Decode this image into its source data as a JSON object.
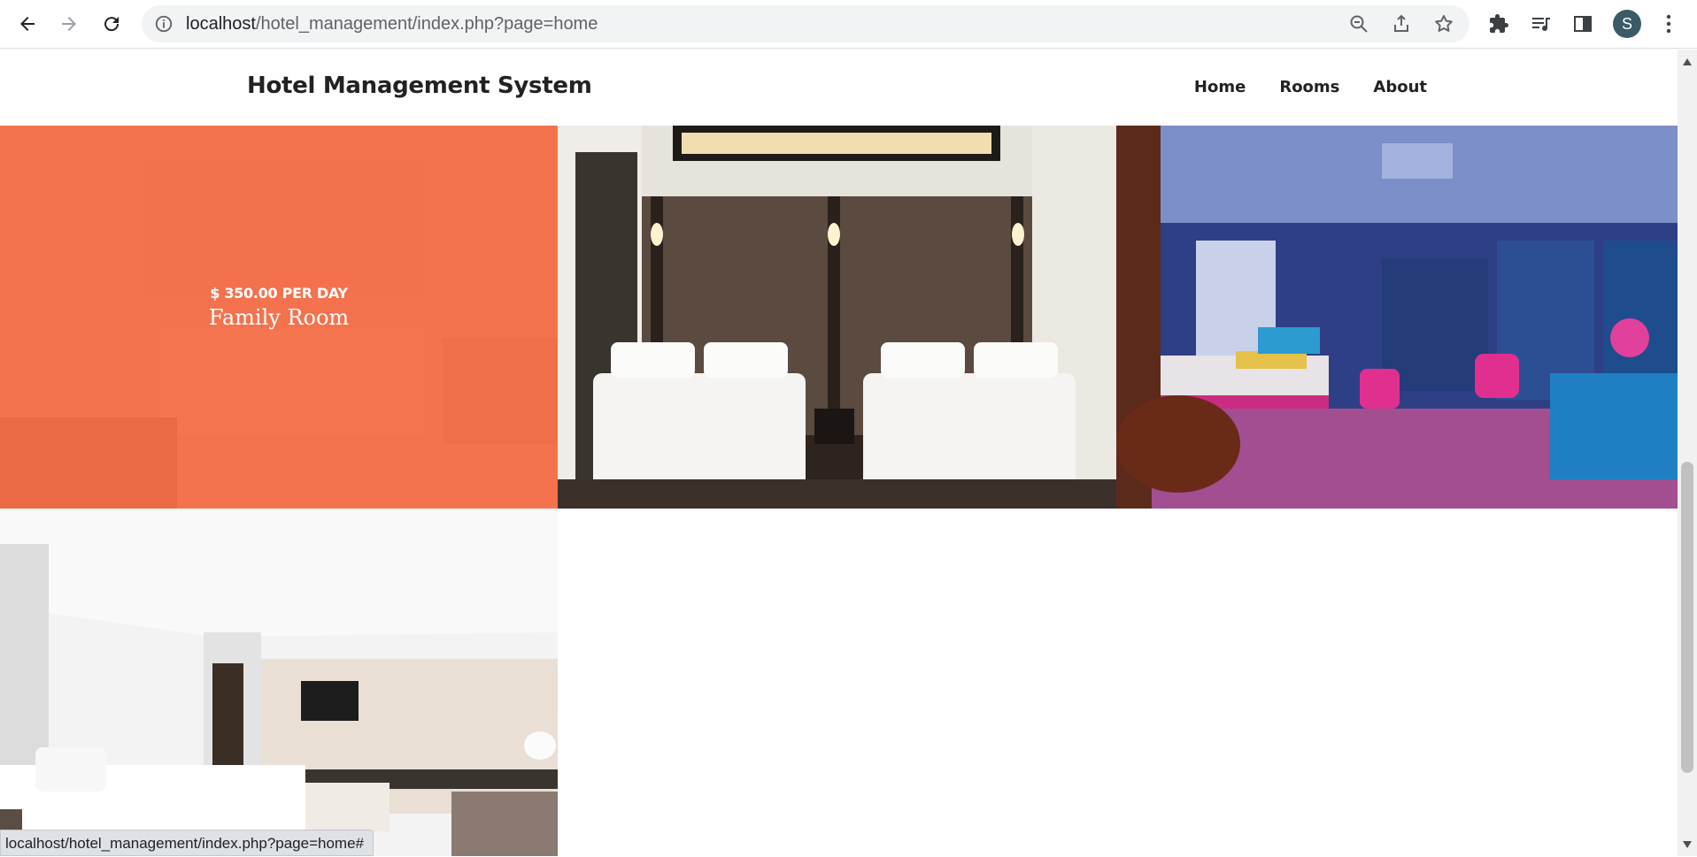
{
  "browser": {
    "url_host": "localhost",
    "url_path": "/hotel_management/index.php?page=home",
    "avatar_initial": "S",
    "status_url": "localhost/hotel_management/index.php?page=home#"
  },
  "site": {
    "brand": "Hotel Management System",
    "nav": [
      "Home",
      "Rooms",
      "About"
    ]
  },
  "rooms": {
    "featured": {
      "price": "$ 350.00 PER DAY",
      "name": "Family Room"
    }
  },
  "icons": [
    "back-icon",
    "forward-icon",
    "reload-icon",
    "info-icon",
    "zoom-icon",
    "share-icon",
    "star-icon",
    "extensions-icon",
    "media-icon",
    "side-panel-icon",
    "menu-icon"
  ],
  "colors": {
    "accent_overlay": "#f66b44",
    "chrome_bg": "#f1f3f4"
  }
}
